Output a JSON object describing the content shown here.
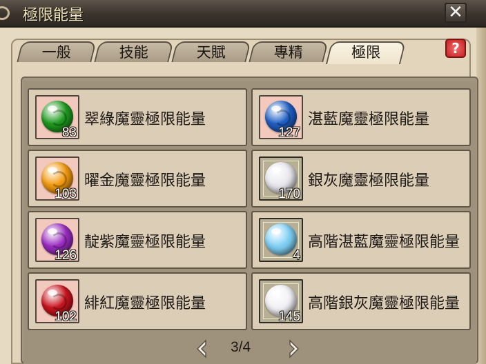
{
  "window": {
    "title": "極限能量",
    "close_glyph": "✕"
  },
  "tabs": [
    {
      "label": "一般",
      "active": false
    },
    {
      "label": "技能",
      "active": false
    },
    {
      "label": "天賦",
      "active": false
    },
    {
      "label": "專精",
      "active": false
    },
    {
      "label": "極限",
      "active": true
    }
  ],
  "help": {
    "glyph": "?"
  },
  "items": [
    {
      "name": "翠綠魔靈極限能量",
      "count": "83",
      "orb": "green-orb-icon",
      "color": "#1f9a1f",
      "frame": "pink"
    },
    {
      "name": "湛藍魔靈極限能量",
      "count": "127",
      "orb": "blue-orb-icon",
      "color": "#1f5fc4",
      "frame": "pink"
    },
    {
      "name": "曜金魔靈極限能量",
      "count": "103",
      "orb": "gold-orb-icon",
      "color": "#f39a10",
      "frame": "pink"
    },
    {
      "name": "銀灰魔靈極限能量",
      "count": "170",
      "orb": "silver-orb-icon",
      "color": "#e8e8ee",
      "frame": "silver"
    },
    {
      "name": "靛紫魔靈極限能量",
      "count": "126",
      "orb": "purple-orb-icon",
      "color": "#9a2cc0",
      "frame": "pink"
    },
    {
      "name": "高階湛藍魔靈極限能量",
      "count": "4",
      "orb": "light-blue-orb-icon",
      "color": "#7fd0f5",
      "frame": "silver"
    },
    {
      "name": "緋紅魔靈極限能量",
      "count": "102",
      "orb": "red-orb-icon",
      "color": "#c8141e",
      "frame": "pink"
    },
    {
      "name": "高階銀灰魔靈極限能量",
      "count": "145",
      "orb": "silver-orb-icon",
      "color": "#f2f2f6",
      "frame": "silver"
    }
  ],
  "pager": {
    "text": "3/4"
  }
}
